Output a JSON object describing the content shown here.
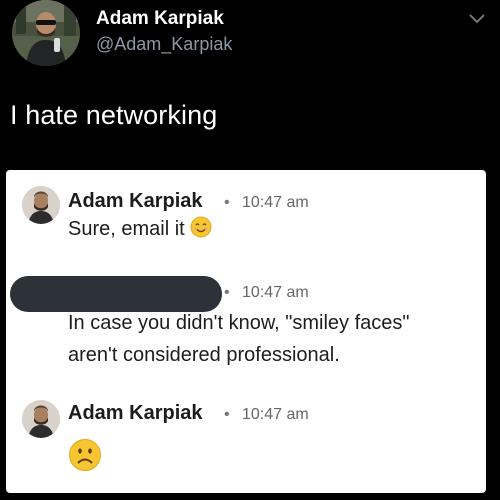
{
  "tweet": {
    "author": {
      "name": "Adam Karpiak",
      "handle": "@Adam_Karpiak"
    },
    "text": "I hate networking"
  },
  "chat": {
    "messages": [
      {
        "sender": "Adam Karpiak",
        "separator": "•",
        "time": "10:47 am",
        "text": "Sure, email it",
        "emoji": "smiling-face-icon"
      },
      {
        "sender_redacted": true,
        "separator": "•",
        "time": "10:47 am",
        "text_line1": "In case you didn't know, \"smiley faces\"",
        "text_line2": "aren't considered professional."
      },
      {
        "sender": "Adam Karpiak",
        "separator": "•",
        "time": "10:47 am",
        "emoji": "frowning-face-icon"
      }
    ]
  },
  "colors": {
    "background": "#000000",
    "handle": "#8b98a5",
    "card": "#ffffff",
    "redaction": "#2c3237",
    "emoji_yellow": "#f7c531"
  }
}
